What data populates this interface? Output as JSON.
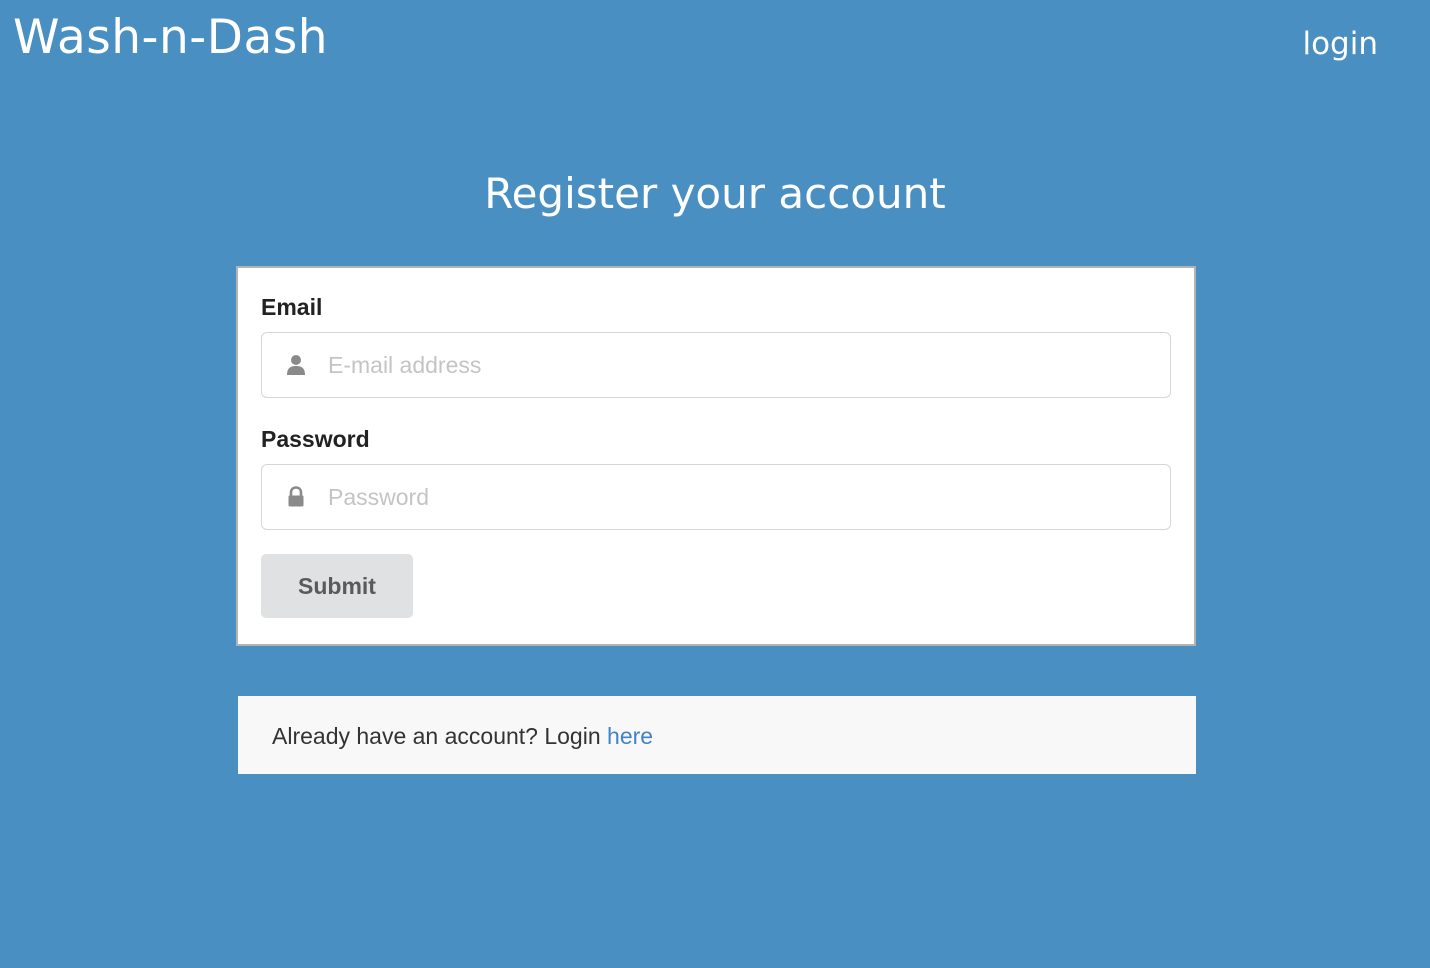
{
  "header": {
    "brand": "Wash-n-Dash",
    "login_link": "login"
  },
  "page": {
    "title": "Register your account"
  },
  "form": {
    "email": {
      "label": "Email",
      "placeholder": "E-mail address",
      "value": "",
      "icon": "user-icon"
    },
    "password": {
      "label": "Password",
      "placeholder": "Password",
      "value": "",
      "icon": "lock-icon"
    },
    "submit_label": "Submit"
  },
  "message": {
    "text": "Already have an account? Login ",
    "link_text": "here"
  },
  "colors": {
    "background": "#4a8fc1",
    "link": "#4183c4",
    "button_bg": "#e0e1e2"
  }
}
